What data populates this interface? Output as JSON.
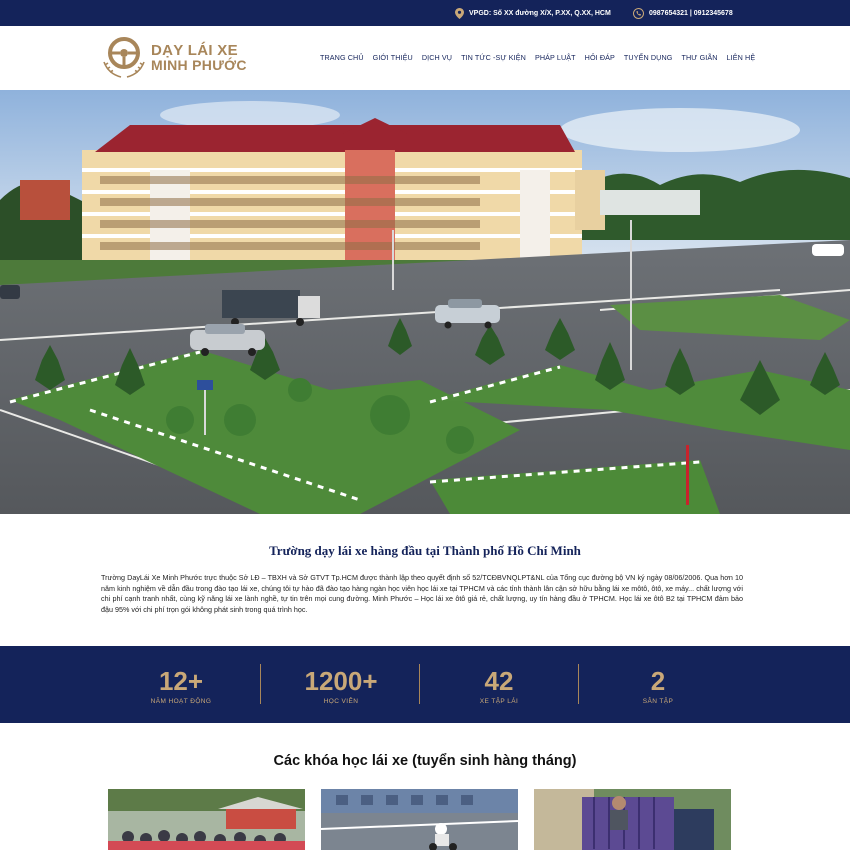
{
  "topbar": {
    "address": "VPGD: Số XX đường X/X, P.XX, Q.XX, HCM",
    "phones": "0987654321 | 0912345678"
  },
  "brand": {
    "line1": "DẠY LÁI XE",
    "line2": "MINH PHƯỚC"
  },
  "nav": {
    "items": [
      "TRANG CHỦ",
      "GIỚI THIỆU",
      "DỊCH VỤ",
      "TIN TỨC -SỰ KIỆN",
      "PHÁP LUẬT",
      "HỎI ĐÁP",
      "TUYỂN DỤNG",
      "THƯ GIÃN",
      "LIÊN HỆ"
    ]
  },
  "intro": {
    "title": "Trường dạy lái xe hàng đầu tại Thành phố Hồ Chí Minh",
    "text": "Trường DayLái Xe Minh Phước trực thuộc Sở LĐ – TBXH và Sở GTVT Tp.HCM được thành lập theo quyết định số 52/TCĐBVNQLPT&NL của Tổng cục đường bộ VN ký ngày 08/06/2006. Qua hơn 10 năm kinh nghiệm về dẫn đầu trong đào tạo lái xe, chúng tôi tự hào đã đào tạo hàng ngàn học viên học lái xe tại TPHCM và các tỉnh thành lân cận sở hữu bằng lái xe môtô, ôtô, xe máy... chất lượng với chi phí cạnh tranh nhất, cùng kỹ năng lái xe lành nghề, tự tin trên mọi cung đường. Minh Phước – Học lái xe ôtô giá rẻ, chất lượng, uy tín hàng đầu ở TPHCM. Học lái xe ôtô B2 tại TPHCM đảm bảo đậu 95% với chi phí trọn gói không phát sinh trong quá trình học."
  },
  "stats": [
    {
      "value": "12+",
      "label": "NĂM HOẠT ĐỘNG"
    },
    {
      "value": "1200+",
      "label": "HỌC VIÊN"
    },
    {
      "value": "42",
      "label": "XE TẬP LÁI"
    },
    {
      "value": "2",
      "label": "SÂN TẬP"
    }
  ],
  "courses": {
    "title": "Các khóa học lái xe (tuyển sinh hàng tháng)"
  },
  "colors": {
    "navy": "#14235a",
    "gold": "#c9a878",
    "brand_gold": "#a8865a"
  },
  "icons": [
    "map-pin-icon",
    "phone-icon",
    "steering-wheel-logo"
  ]
}
